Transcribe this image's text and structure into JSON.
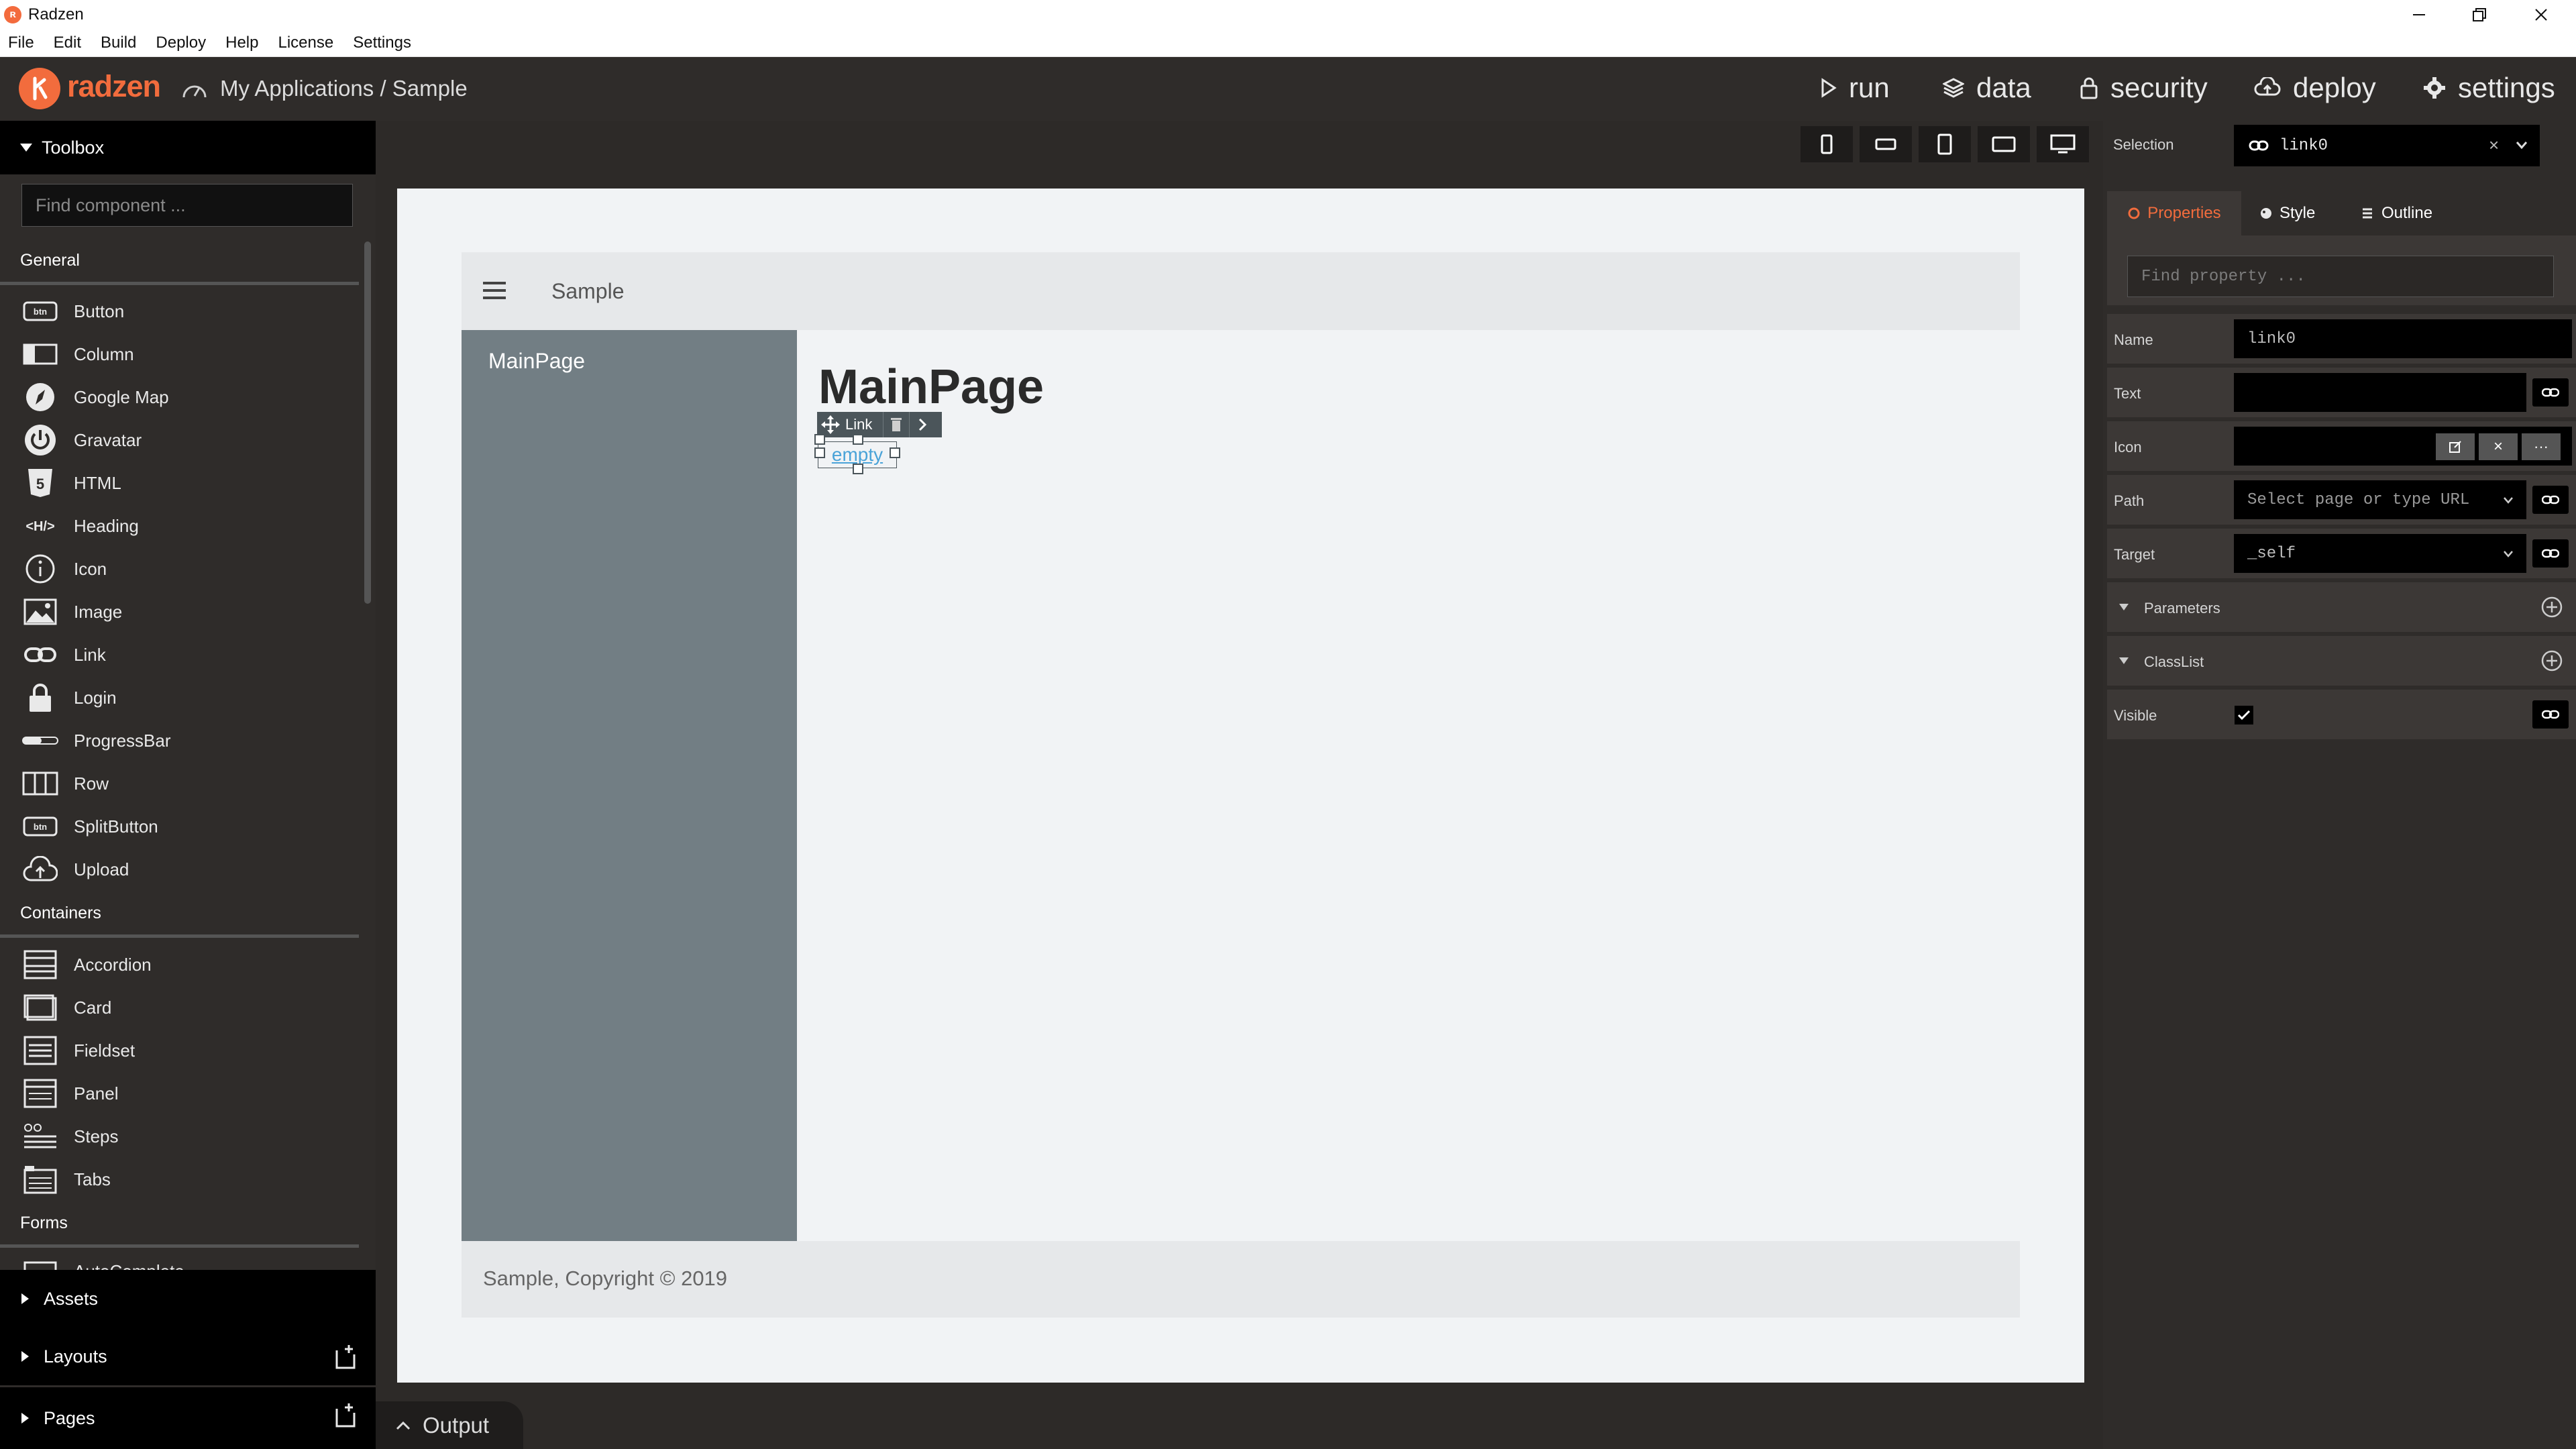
{
  "window": {
    "title": "Radzen"
  },
  "menu": [
    "File",
    "Edit",
    "Build",
    "Deploy",
    "Help",
    "License",
    "Settings"
  ],
  "header": {
    "logo": "radzen",
    "breadcrumb": "My Applications / Sample",
    "nav": {
      "run": "run",
      "data": "data",
      "security": "security",
      "deploy": "deploy",
      "settings": "settings"
    }
  },
  "toolbox": {
    "title": "Toolbox",
    "search_placeholder": "Find component ...",
    "sections": {
      "general": "General",
      "containers": "Containers",
      "forms": "Forms"
    },
    "general": [
      "Button",
      "Column",
      "Google Map",
      "Gravatar",
      "HTML",
      "Heading",
      "Icon",
      "Image",
      "Link",
      "Login",
      "ProgressBar",
      "Row",
      "SplitButton",
      "Upload"
    ],
    "containers": [
      "Accordion",
      "Card",
      "Fieldset",
      "Panel",
      "Steps",
      "Tabs"
    ],
    "forms_partial": "AutoComplete",
    "bottom": {
      "assets": "Assets",
      "layouts": "Layouts",
      "pages": "Pages"
    }
  },
  "canvas": {
    "header_title": "Sample",
    "sidebar_item": "MainPage",
    "heading": "MainPage",
    "link_toolbar_label": "Link",
    "link_text": "empty",
    "footer": "Sample, Copyright © 2019"
  },
  "properties": {
    "selection_label": "Selection",
    "selection_value": "link0",
    "tabs": {
      "properties": "Properties",
      "style": "Style",
      "outline": "Outline"
    },
    "search_placeholder": "Find property ...",
    "rows": {
      "name_label": "Name",
      "name_value": "link0",
      "text_label": "Text",
      "icon_label": "Icon",
      "path_label": "Path",
      "path_placeholder": "Select page or type URL",
      "target_label": "Target",
      "target_value": "_self",
      "parameters_label": "Parameters",
      "classlist_label": "ClassList",
      "visible_label": "Visible"
    }
  },
  "output": {
    "label": "Output"
  },
  "colors": {
    "brand": "#f26c3d",
    "accent_tab": "#f26c3d",
    "panel": "#2f2c2a"
  }
}
